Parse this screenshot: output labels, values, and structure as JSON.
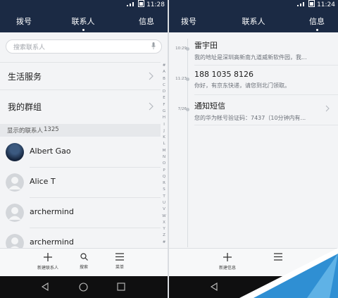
{
  "left": {
    "status_time": "11:28",
    "tabs": [
      "拨号",
      "联系人",
      "信息"
    ],
    "search_placeholder": "搜索联系人",
    "sections": [
      "生活服务",
      "我的群组"
    ],
    "group_header": {
      "label": "显示的联系人",
      "count": "1325"
    },
    "contacts": [
      "Albert Gao",
      "Alice T",
      "archermind",
      "archermind"
    ],
    "index_letters": [
      "#",
      "A",
      "B",
      "C",
      "D",
      "E",
      "F",
      "G",
      "H",
      "I",
      "J",
      "K",
      "L",
      "M",
      "N",
      "O",
      "P",
      "Q",
      "R",
      "S",
      "T",
      "U",
      "V",
      "W",
      "X",
      "Y",
      "Z",
      "#"
    ],
    "bottom_actions": [
      "新建联系人",
      "搜索",
      "菜单"
    ]
  },
  "right": {
    "status_time": "11:24",
    "tabs": [
      "拨号",
      "联系人",
      "信息"
    ],
    "messages": [
      {
        "stamp": "10:29",
        "title": "雷宇田",
        "preview": "我的地址是深圳高新南九道威新软件园，我..."
      },
      {
        "stamp": "11:23",
        "title": "188 1035 8126",
        "preview": "你好，有京东快递，请您到北门领取。"
      },
      {
        "stamp": "7/26",
        "title": "通知短信",
        "preview": "您的华为帐号验证码：7437（10分钟内有..."
      }
    ],
    "bottom_actions": [
      "新建信息"
    ]
  },
  "colors": {
    "header": "#1b2a44",
    "accent_corner": "#2f8fd3"
  },
  "icons": [
    "signal-icon",
    "battery-icon",
    "mic-icon",
    "chevron-right-icon",
    "plus-icon",
    "search-icon",
    "menu-icon",
    "back-icon",
    "home-icon",
    "recents-icon"
  ]
}
